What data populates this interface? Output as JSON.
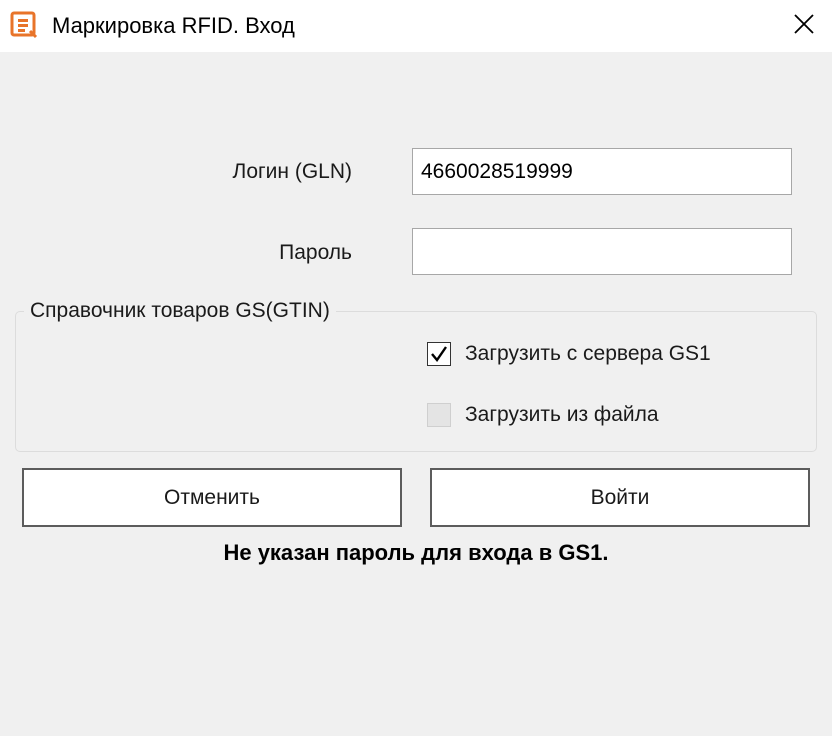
{
  "window": {
    "title": "Маркировка RFID. Вход",
    "icon": "app-logo-icon",
    "close_icon": "close-icon",
    "accent_color": "#e8742a"
  },
  "form": {
    "login_label": "Логин (GLN)",
    "login_value": "4660028519999",
    "password_label": "Пароль",
    "password_value": ""
  },
  "groupbox": {
    "legend": "Справочник товаров GS(GTIN)",
    "options": [
      {
        "label": "Загрузить с сервера GS1",
        "checked": true,
        "enabled": true
      },
      {
        "label": "Загрузить из файла",
        "checked": false,
        "enabled": false
      }
    ]
  },
  "buttons": {
    "cancel_label": "Отменить",
    "login_label": "Войти"
  },
  "status": {
    "message": "Не указан пароль для входа в GS1."
  }
}
